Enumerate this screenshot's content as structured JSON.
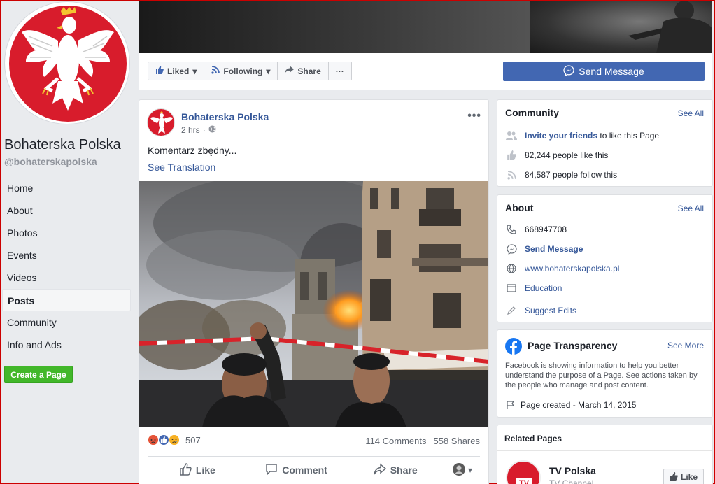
{
  "page": {
    "name": "Bohaterska Polska",
    "handle": "@bohaterskapolska"
  },
  "nav": {
    "items": [
      {
        "label": "Home"
      },
      {
        "label": "About"
      },
      {
        "label": "Photos"
      },
      {
        "label": "Events"
      },
      {
        "label": "Videos"
      },
      {
        "label": "Posts",
        "active": true
      },
      {
        "label": "Community"
      },
      {
        "label": "Info and Ads"
      }
    ],
    "create_page": "Create a Page"
  },
  "actionbar": {
    "liked": "Liked",
    "following": "Following",
    "share": "Share",
    "more": "···",
    "send_message": "Send Message"
  },
  "post": {
    "author": "Bohaterska Polska",
    "time": "2 hrs",
    "text": "Komentarz zbędny...",
    "see_translation": "See Translation",
    "reaction_count": "507",
    "comments": "114 Comments",
    "shares": "558 Shares",
    "like_label": "Like",
    "comment_label": "Comment",
    "share_label": "Share"
  },
  "community": {
    "title": "Community",
    "see_all": "See All",
    "invite_link": "Invite your friends",
    "invite_rest": "to like this Page",
    "likes": "82,244 people like this",
    "follows": "84,587 people follow this"
  },
  "about": {
    "title": "About",
    "see_all": "See All",
    "phone": "668947708",
    "send_message": "Send Message",
    "website": "www.bohaterskapolska.pl",
    "category": "Education",
    "suggest": "Suggest Edits"
  },
  "transparency": {
    "title": "Page Transparency",
    "see_more": "See More",
    "description": "Facebook is showing information to help you better understand the purpose of a Page. See actions taken by the people who manage and post content.",
    "created": "Page created - March 14, 2015"
  },
  "related": {
    "title": "Related Pages",
    "item_name": "TV Polska",
    "item_category": "TV Channel",
    "like_label": "Like",
    "logo_text": "TV"
  },
  "colors": {
    "brand_blue": "#4267b2",
    "link_blue": "#365899",
    "green": "#42b72a",
    "emblem_red": "#d81c2c"
  }
}
